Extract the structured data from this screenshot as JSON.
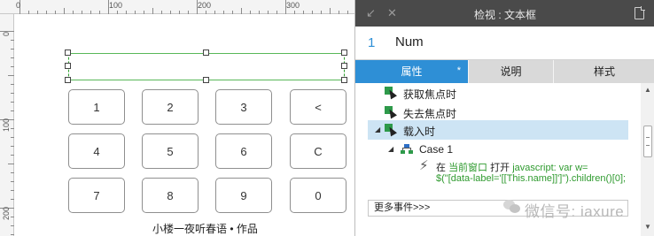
{
  "canvas": {
    "ruler": {
      "top_labels": [
        "0",
        "100",
        "200",
        "300"
      ],
      "left_labels": [
        "0",
        "100",
        "200"
      ]
    },
    "keypad": {
      "rows": [
        [
          "1",
          "2",
          "3",
          "<"
        ],
        [
          "4",
          "5",
          "6",
          "C"
        ],
        [
          "7",
          "8",
          "9",
          "0"
        ]
      ]
    },
    "caption": "小楼一夜听春语 • 作品"
  },
  "panel": {
    "title": "检视 : 文本框",
    "name_index": "1",
    "name_value": "Num",
    "tabs": [
      {
        "label": "属性",
        "active": true,
        "modified_mark": "*"
      },
      {
        "label": "说明",
        "active": false
      },
      {
        "label": "样式",
        "active": false
      }
    ],
    "events": [
      {
        "label": "获取焦点时"
      },
      {
        "label": "失去焦点时"
      },
      {
        "label": "载入时",
        "expanded": true,
        "selected": true
      }
    ],
    "case": {
      "label": "Case 1"
    },
    "action": {
      "prefix": "在",
      "target": "当前窗口",
      "verb": "打开",
      "line1": "javascript: var w=",
      "line2": "$(\"[data-label='[[This.name]]']\").children()[0];"
    },
    "more_events": "更多事件>>>",
    "colors": {
      "accent": "#2e8fd6",
      "selected_row": "#cde4f4",
      "event_icon": "#2e9a4a",
      "action_link": "#2e9a2e"
    }
  },
  "watermark": {
    "text": "微信号: iaxure"
  }
}
